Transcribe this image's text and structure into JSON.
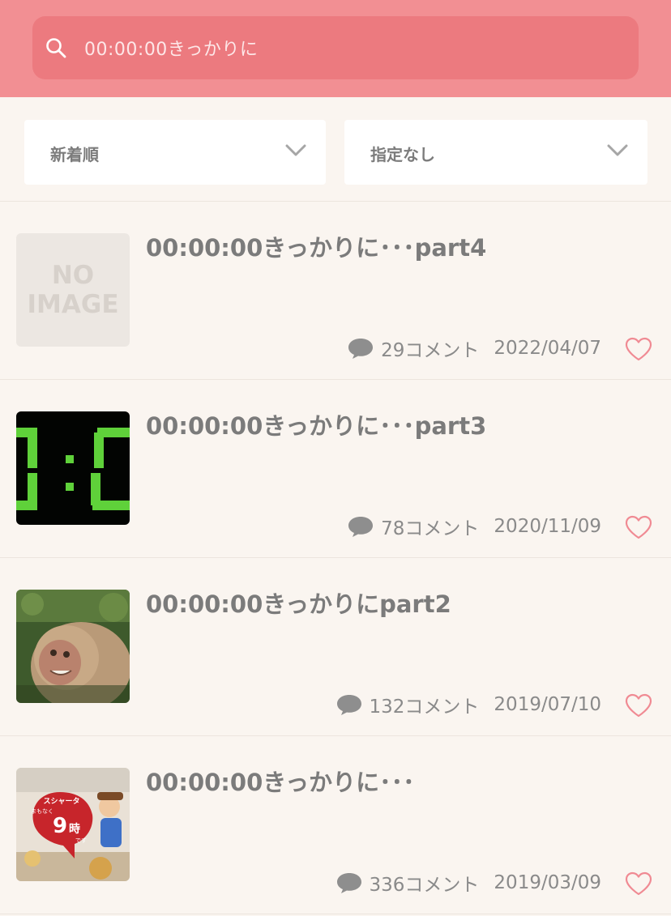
{
  "search": {
    "query": "00:00:00きっかりに",
    "icon": "search-icon"
  },
  "filters": {
    "sort": {
      "label": "新着順",
      "icon": "chevron-down-icon"
    },
    "filter": {
      "label": "指定なし",
      "icon": "chevron-down-icon"
    }
  },
  "posts": [
    {
      "title": "00:00:00きっかりに･･･part4",
      "comments": "29コメント",
      "date": "2022/04/07",
      "thumbnail": "no-image-placeholder",
      "no_image_line1": "NO",
      "no_image_line2": "IMAGE"
    },
    {
      "title": "00:00:00きっかりに･･･part3",
      "comments": "78コメント",
      "date": "2020/11/09",
      "thumbnail": "digital-clock-image"
    },
    {
      "title": "00:00:00きっかりにpart2",
      "comments": "132コメント",
      "date": "2019/07/10",
      "thumbnail": "monkey-photo"
    },
    {
      "title": "00:00:00きっかりに･･･",
      "comments": "336コメント",
      "date": "2019/03/09",
      "thumbnail": "cartoon-ad-image",
      "thumb_text_brand": "スシャータ",
      "thumb_text_small": "まもなく",
      "thumb_text_big": "9",
      "thumb_text_unit": "時",
      "thumb_text_tail": "です"
    }
  ],
  "colors": {
    "header": "#f28f93",
    "search_box": "#ec7a7f",
    "background": "#faf5f0",
    "heart": "#f08a93"
  }
}
